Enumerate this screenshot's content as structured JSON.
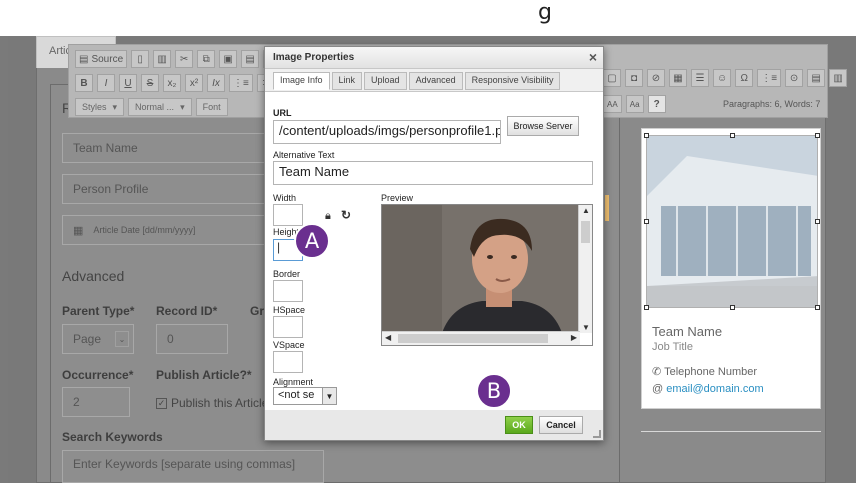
{
  "top_text": "g",
  "article_tab": "Artic",
  "background_form": {
    "team_name_placeholder": "Team Name",
    "person_profile_placeholder": "Person Profile",
    "article_date_placeholder": "Article Date [dd/mm/yyyy]",
    "section_heading": "Advanced",
    "parent_type_label": "Parent Type*",
    "parent_type_value": "Page",
    "record_id_label": "Record ID*",
    "record_id_value": "0",
    "gr_label": "Gr",
    "occurrence_label": "Occurrence*",
    "occurrence_value": "2",
    "publish_label": "Publish Article?*",
    "publish_checkbox_label": "Publish this Article",
    "search_keywords_label": "Search Keywords",
    "search_keywords_placeholder": "Enter Keywords [separate using commas]",
    "r_heading": "R"
  },
  "toolbar": {
    "source_label": "Source",
    "styles_label": "Styles",
    "format_label": "Normal ...",
    "font_label": "Font",
    "para_count": "Paragraphs: 6, Words: 7",
    "help_label": "?"
  },
  "profile_card": {
    "name": "Team Name",
    "job_title": "Job Title",
    "phone": "Telephone Number",
    "email": "email@domain.com"
  },
  "dialog": {
    "title": "Image Properties",
    "close": "×",
    "tabs": [
      "Image Info",
      "Link",
      "Upload",
      "Advanced",
      "Responsive Visibility"
    ],
    "url_label": "URL",
    "url_value": "/content/uploads/imgs/personprofile1.pi",
    "browse_server": "Browse Server",
    "alt_label": "Alternative Text",
    "alt_value": "Team Name",
    "width_label": "Width",
    "height_label": "Height",
    "height_value": "|",
    "border_label": "Border",
    "hspace_label": "HSpace",
    "vspace_label": "VSpace",
    "alignment_label": "Alignment",
    "alignment_value": "<not se",
    "preview_label": "Preview",
    "ok_label": "OK",
    "cancel_label": "Cancel"
  },
  "markers": [
    "A",
    "B"
  ],
  "colors": {
    "marker": "#6a2f8f",
    "ok_green": "#6ab82a",
    "email_link": "#2a8fc2"
  }
}
